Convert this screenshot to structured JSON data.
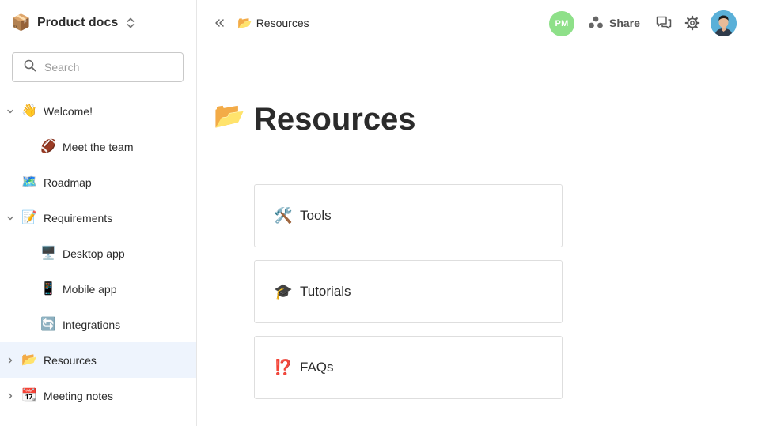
{
  "workspace": {
    "emoji": "📦",
    "name": "Product docs"
  },
  "search": {
    "placeholder": "Search",
    "value": ""
  },
  "sidebar": {
    "items": [
      {
        "emoji": "👋",
        "label": "Welcome!",
        "level": 0,
        "chevron": "down",
        "active": false
      },
      {
        "emoji": "🏈",
        "label": "Meet the team",
        "level": 1,
        "chevron": "none",
        "active": false
      },
      {
        "emoji": "🗺️",
        "label": "Roadmap",
        "level": 0,
        "chevron": "none",
        "active": false
      },
      {
        "emoji": "📝",
        "label": "Requirements",
        "level": 0,
        "chevron": "down",
        "active": false
      },
      {
        "emoji": "🖥️",
        "label": "Desktop app",
        "level": 1,
        "chevron": "none",
        "active": false
      },
      {
        "emoji": "📱",
        "label": "Mobile app",
        "level": 1,
        "chevron": "none",
        "active": false
      },
      {
        "emoji": "🔄",
        "label": "Integrations",
        "level": 1,
        "chevron": "none",
        "active": false
      },
      {
        "emoji": "📂",
        "label": "Resources",
        "level": 0,
        "chevron": "right",
        "active": true
      },
      {
        "emoji": "📆",
        "label": "Meeting notes",
        "level": 0,
        "chevron": "right",
        "active": false
      }
    ]
  },
  "topbar": {
    "breadcrumb_emoji": "📂",
    "breadcrumb_label": "Resources",
    "presence_initials": "PM",
    "share_label": "Share"
  },
  "page": {
    "emoji": "📂",
    "title": "Resources",
    "cards": [
      {
        "emoji": "🛠️",
        "label": "Tools"
      },
      {
        "emoji": "🎓",
        "label": "Tutorials"
      },
      {
        "emoji": "⁉️",
        "label": "FAQs"
      }
    ]
  },
  "colors": {
    "active_row": "#eef4fd",
    "presence_avatar": "#8ee089",
    "border": "#dedede"
  }
}
